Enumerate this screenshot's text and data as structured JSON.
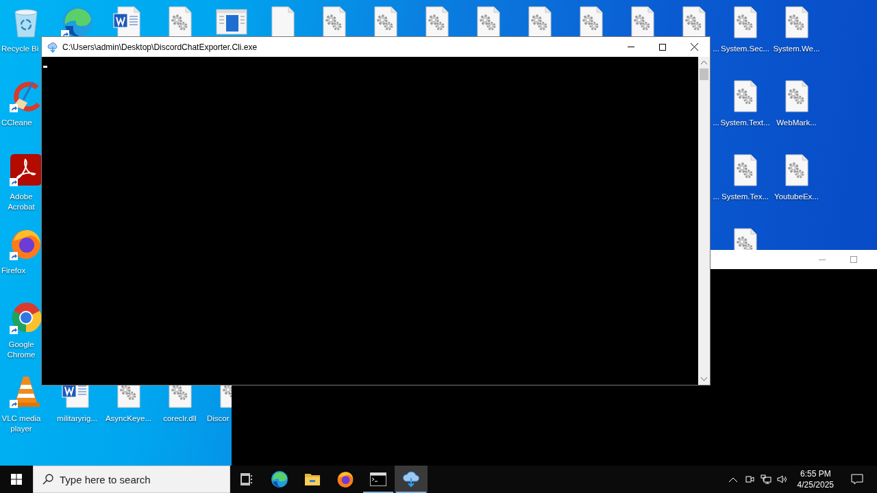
{
  "desktop": {
    "left_column": [
      {
        "kind": "recycle-bin",
        "label": "Recycle Bi",
        "shortcut": false
      },
      {
        "kind": "ccleaner",
        "label": "CCleane",
        "shortcut": true
      },
      {
        "kind": "acrobat",
        "label": "Adobe Acrobat",
        "shortcut": true
      },
      {
        "kind": "firefox",
        "label": "Firefox",
        "shortcut": true
      },
      {
        "kind": "chrome",
        "label": "Google Chrome",
        "shortcut": true
      },
      {
        "kind": "vlc",
        "label": "VLC media player",
        "shortcut": true
      }
    ],
    "top_row": [
      {
        "kind": "edge",
        "shortcut": true
      },
      {
        "kind": "word-doc",
        "shortcut": false
      },
      {
        "kind": "gear-file",
        "shortcut": false
      },
      {
        "kind": "window-file",
        "shortcut": false
      },
      {
        "kind": "blank-file",
        "shortcut": false
      },
      {
        "kind": "gear-file",
        "shortcut": false
      },
      {
        "kind": "gear-file",
        "shortcut": false
      },
      {
        "kind": "gear-file",
        "shortcut": false
      },
      {
        "kind": "gear-file",
        "shortcut": false
      },
      {
        "kind": "gear-file",
        "shortcut": false
      },
      {
        "kind": "gear-file",
        "shortcut": false
      },
      {
        "kind": "gear-file",
        "shortcut": false
      }
    ],
    "bottom_row": [
      {
        "kind": "word-doc",
        "label": "militaryrig...",
        "shortcut": false
      },
      {
        "kind": "gear-file",
        "label": "AsyncKeye...",
        "shortcut": false
      },
      {
        "kind": "gear-file",
        "label": "coreclr.dll",
        "shortcut": false
      },
      {
        "kind": "gear-file",
        "label": "Discor",
        "shortcut": false
      }
    ],
    "right_columns": [
      [
        {
          "kind": "gear-file",
          "label": "...",
          "shortcut": false
        },
        {
          "kind": "covered",
          "label": "...",
          "shortcut": false
        },
        {
          "kind": "covered",
          "label": "...",
          "shortcut": false
        }
      ],
      [
        {
          "kind": "gear-file",
          "label": "System.Sec...",
          "shortcut": false
        },
        {
          "kind": "gear-file",
          "label": "System.Text...",
          "shortcut": false
        },
        {
          "kind": "gear-file",
          "label": "System.Tex...",
          "shortcut": false
        },
        {
          "kind": "gear-file",
          "shortcut": false
        }
      ],
      [
        {
          "kind": "gear-file",
          "label": "System.We...",
          "shortcut": false
        },
        {
          "kind": "gear-file",
          "label": "WebMark...",
          "shortcut": false
        },
        {
          "kind": "gear-file",
          "label": "YoutubeEx...",
          "shortcut": false
        }
      ]
    ]
  },
  "console_window": {
    "title": "C:\\Users\\admin\\Desktop\\DiscordChatExporter.Cli.exe"
  },
  "taskbar": {
    "search": {
      "placeholder": "Type here to search"
    },
    "apps": [
      {
        "kind": "task-view",
        "running": false,
        "selected": false
      },
      {
        "kind": "edge",
        "running": false,
        "selected": false
      },
      {
        "kind": "explorer",
        "running": false,
        "selected": false
      },
      {
        "kind": "firefox",
        "running": false,
        "selected": false
      },
      {
        "kind": "console",
        "running": true,
        "selected": false
      },
      {
        "kind": "cloud-app",
        "running": true,
        "selected": true
      }
    ],
    "clock": {
      "time": "6:55 PM",
      "date": "4/25/2025"
    }
  }
}
